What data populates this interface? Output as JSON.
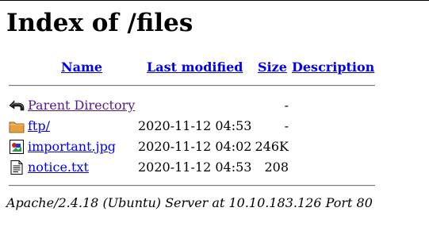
{
  "page": {
    "title": "Index of /files"
  },
  "table": {
    "columns": {
      "name": "Name",
      "last_modified": "Last modified",
      "size": "Size",
      "description": "Description"
    },
    "rows": [
      {
        "icon": "back-arrow-icon",
        "name": "Parent Directory",
        "date": "",
        "size": "-",
        "description": ""
      },
      {
        "icon": "folder-icon",
        "name": "ftp/",
        "date": "2020-11-12 04:53",
        "size": "-",
        "description": ""
      },
      {
        "icon": "image-file-icon",
        "name": "important.jpg",
        "date": "2020-11-12 04:02",
        "size": "246K",
        "description": ""
      },
      {
        "icon": "text-file-icon",
        "name": "notice.txt",
        "date": "2020-11-12 04:53",
        "size": "208",
        "description": ""
      }
    ]
  },
  "footer": {
    "address": "Apache/2.4.18 (Ubuntu) Server at 10.10.183.126 Port 80"
  }
}
